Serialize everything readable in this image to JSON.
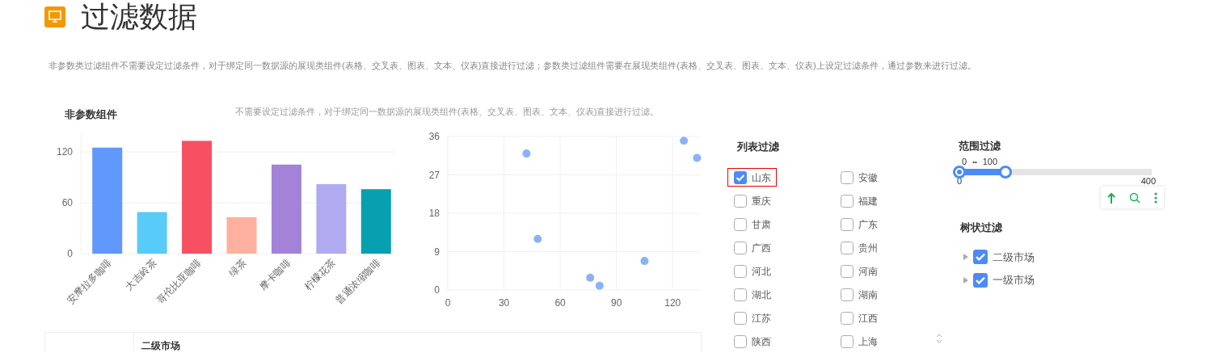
{
  "header": {
    "title": "过滤数据"
  },
  "description": "非参数类过滤组件不需要设定过滤条件，对于绑定同一数据源的展现类组件(表格、交叉表、图表、文本、仪表)直接进行过滤；参数类过滤组件需要在展现类组件(表格、交叉表、图表、文本、仪表)上设定过滤条件，通过参数来进行过滤。",
  "non_param": {
    "title": "非参数组件",
    "note": "不需要设定过滤条件，对于绑定同一数据源的展现类组件(表格、交叉表、图表、文本、仪表)直接进行过滤。",
    "bar_chart": {
      "chart_data": {
        "type": "bar",
        "categories": [
          "安摩拉多咖啡",
          "大吉岭茶",
          "哥伦比亚咖啡",
          "绿茶",
          "摩卡咖啡",
          "柠檬花茶",
          "普通浓缩咖啡"
        ],
        "values": [
          125,
          49,
          133,
          43,
          105,
          82,
          76
        ],
        "colors": [
          "#6098fc",
          "#58cbf8",
          "#f75062",
          "#ffb09f",
          "#a283d8",
          "#b0abf0",
          "#06a0b1"
        ],
        "ylim": [
          0,
          140
        ],
        "yticks": [
          0,
          60,
          120
        ]
      }
    },
    "scatter_chart": {
      "chart_data": {
        "type": "scatter",
        "x": [
          42,
          48,
          76,
          81,
          105,
          126,
          133
        ],
        "series": [
          {
            "color": "#8ab2fb",
            "values": [
              32,
              12,
              2.9,
              1,
              6.8,
              35,
              31
            ]
          }
        ],
        "grid": true,
        "xlim": [
          0,
          135
        ],
        "ylim": [
          0,
          36
        ],
        "xticks": [
          0,
          30,
          60,
          90,
          120
        ],
        "yticks": [
          0,
          9,
          18,
          27,
          36
        ]
      }
    },
    "table": {
      "columns": [
        "二级市场"
      ]
    }
  },
  "list_filter": {
    "title": "列表过滤",
    "items": [
      {
        "label": "山东",
        "checked": true,
        "focused": true
      },
      {
        "label": "安徽",
        "checked": false,
        "focused": false
      },
      {
        "label": "重庆",
        "checked": false,
        "focused": false
      },
      {
        "label": "福建",
        "checked": false,
        "focused": false
      },
      {
        "label": "甘肃",
        "checked": false,
        "focused": false
      },
      {
        "label": "广东",
        "checked": false,
        "focused": false
      },
      {
        "label": "广西",
        "checked": false,
        "focused": false
      },
      {
        "label": "贵州",
        "checked": false,
        "focused": false
      },
      {
        "label": "河北",
        "checked": false,
        "focused": false
      },
      {
        "label": "河南",
        "checked": false,
        "focused": false
      },
      {
        "label": "湖北",
        "checked": false,
        "focused": false
      },
      {
        "label": "湖南",
        "checked": false,
        "focused": false
      },
      {
        "label": "江苏",
        "checked": false,
        "focused": false
      },
      {
        "label": "江西",
        "checked": false,
        "focused": false
      },
      {
        "label": "陕西",
        "checked": false,
        "focused": false
      },
      {
        "label": "上海",
        "checked": false,
        "focused": false
      }
    ]
  },
  "range_filter": {
    "title": "范围过滤",
    "low_label": "0",
    "separator": "••",
    "high_label": "100",
    "min": "0",
    "max": "400",
    "level": 0.25
  },
  "tree_filter": {
    "title": "树状过滤",
    "items": [
      {
        "label": "二级市场",
        "checked": true,
        "expanded": false
      },
      {
        "label": "一级市场",
        "checked": true,
        "expanded": false
      }
    ]
  }
}
